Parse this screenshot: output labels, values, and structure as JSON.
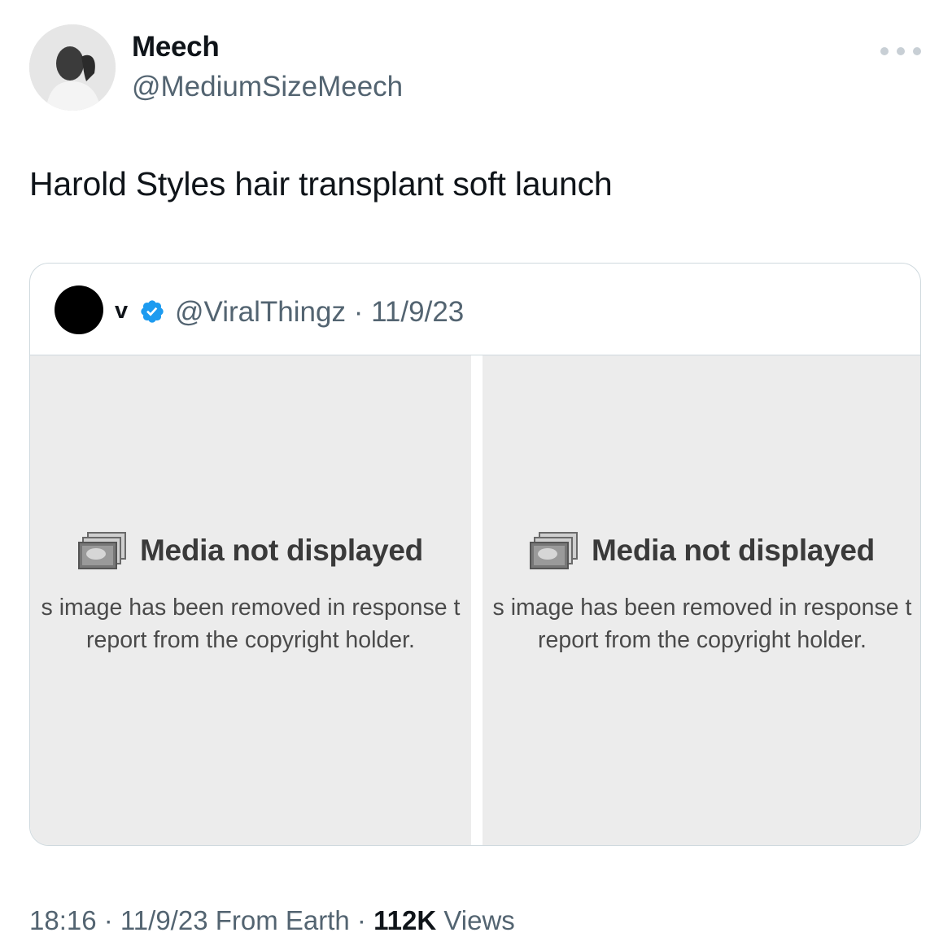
{
  "author": {
    "name": "Meech",
    "handle": "@MediumSizeMeech"
  },
  "tweet": {
    "text": "Harold Styles hair transplant soft launch"
  },
  "quoted_tweet": {
    "name": "v",
    "meta": "@ViralThingz · 11/9/23",
    "media": [
      {
        "title": "Media not displayed",
        "line1": "s image has been removed in response t",
        "line2": "report from the copyright holder."
      },
      {
        "title": "Media not displayed",
        "line1": "s image has been removed in response t",
        "line2": "report from the copyright holder."
      }
    ]
  },
  "footer": {
    "time_date": "18:16 · 11/9/23 From Earth · ",
    "views_count": "112K",
    "views_label": " Views"
  },
  "colors": {
    "secondary_text": "#536471",
    "verified": "#1d9bf0",
    "media_bg": "#ececec"
  },
  "icons": [
    "more-icon",
    "verified-icon",
    "media-placeholder-icon"
  ]
}
